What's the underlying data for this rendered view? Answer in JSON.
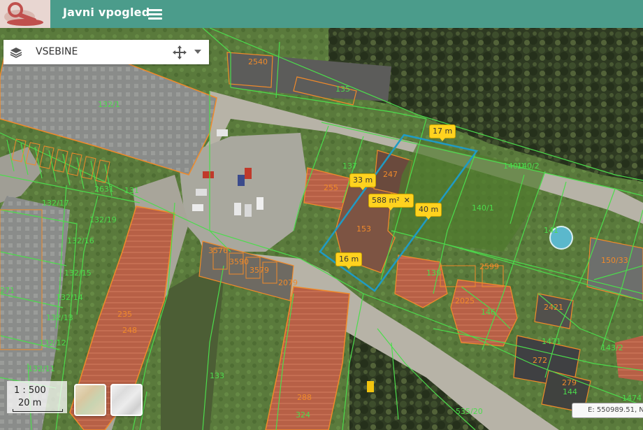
{
  "app": {
    "title": "Javni vpogled"
  },
  "contents_panel": {
    "title": "VSEBINE"
  },
  "measurements": {
    "area": "588 m²",
    "edges": [
      "17 m",
      "33 m",
      "40 m",
      "16 m"
    ]
  },
  "parcel_labels": [
    "135",
    "132/1",
    "247",
    "137",
    "140/1",
    "140/1",
    "141",
    "140/2",
    "150/33",
    "153",
    "139",
    "2025",
    "2599",
    "146",
    "144",
    "279",
    "272",
    "1471",
    "143/2",
    "235",
    "133",
    "324",
    "288",
    "535/20",
    "271",
    "132/17",
    "132/19",
    "132/16",
    "132/15",
    "132/14",
    "132/13",
    "132/12",
    "132/11",
    "2540",
    "255",
    "2421",
    "248",
    "3576",
    "3590",
    "3579",
    "2079",
    "2631",
    "131",
    "1474"
  ],
  "scale": {
    "ratio": "1 : 500",
    "distance": "20 m"
  },
  "basemaps": [
    "topographic",
    "relief"
  ],
  "coordinates": {
    "text": "E: 550989.51, N"
  },
  "colors": {
    "header": "#4b9c8b",
    "parcel_lines": "#4cdc4c",
    "building_outlines": "#f08a2a",
    "measure_polygon": "#1f9bc4",
    "measure_labels": "#ffd21f"
  },
  "icons": {
    "menu": "hamburger-icon",
    "layers": "layers-icon",
    "move": "move-icon",
    "dropdown": "caret-down-icon",
    "close": "close-icon"
  }
}
